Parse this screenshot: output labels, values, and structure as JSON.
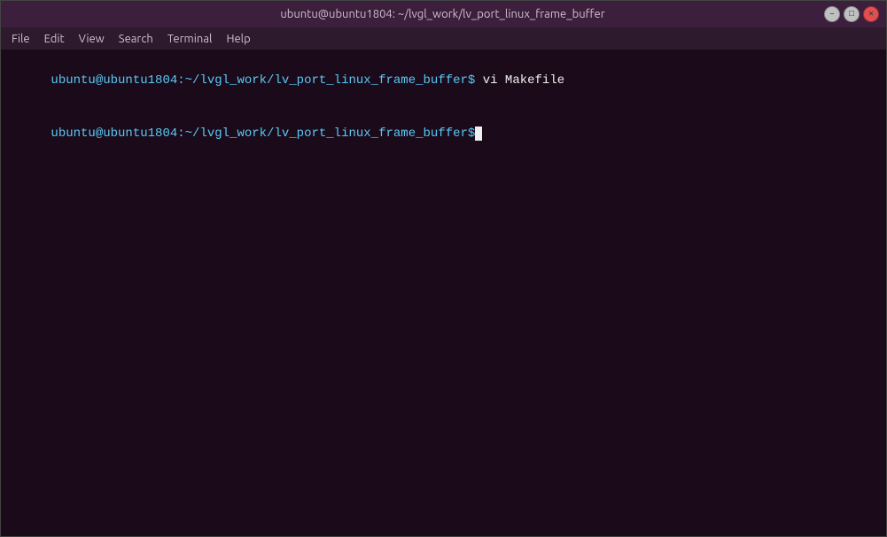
{
  "window": {
    "title": "ubuntu@ubuntu1804: ~/lvgl_work/lv_port_linux_frame_buffer",
    "controls": {
      "close_label": "",
      "minimize_label": "",
      "maximize_label": ""
    }
  },
  "menubar": {
    "items": [
      {
        "id": "file",
        "label": "File"
      },
      {
        "id": "edit",
        "label": "Edit"
      },
      {
        "id": "view",
        "label": "View"
      },
      {
        "id": "search",
        "label": "Search"
      },
      {
        "id": "terminal",
        "label": "Terminal"
      },
      {
        "id": "help",
        "label": "Help"
      }
    ]
  },
  "terminal": {
    "lines": [
      {
        "prompt": "ubuntu@ubuntu1804:~/lvgl_work/lv_port_linux_frame_buffer$",
        "command": " vi Makefile"
      },
      {
        "prompt": "ubuntu@ubuntu1804:~/lvgl_work/lv_port_linux_frame_buffer$",
        "command": " "
      }
    ]
  }
}
